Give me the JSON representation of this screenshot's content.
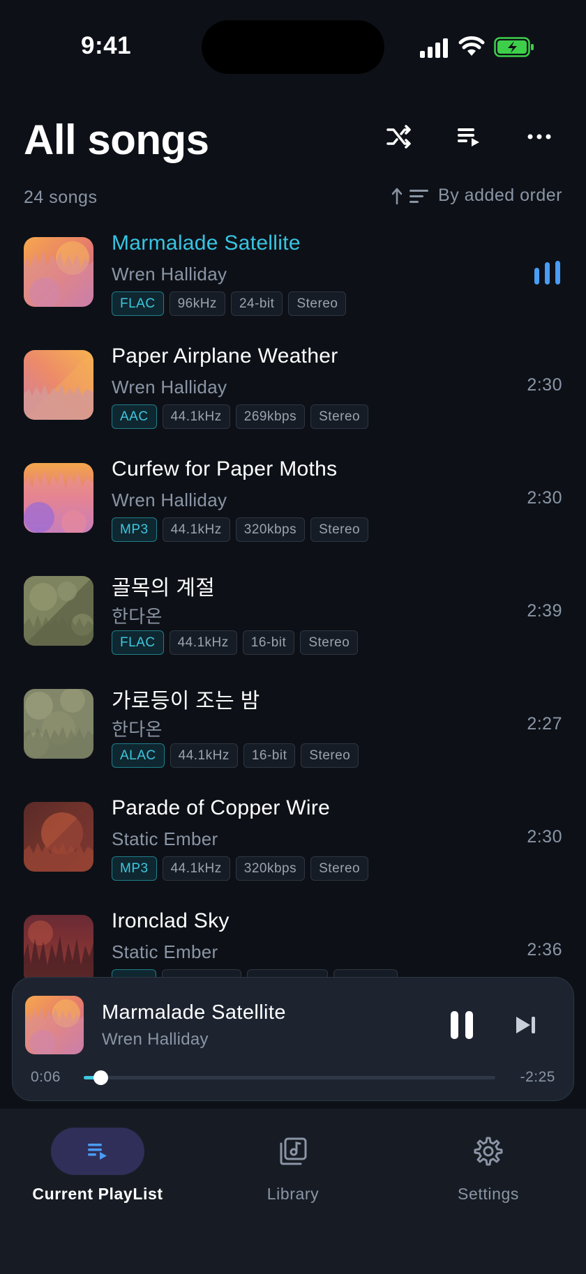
{
  "status_bar": {
    "time": "9:41"
  },
  "header": {
    "title": "All songs",
    "song_count": "24 songs",
    "sort_label": "By added order"
  },
  "songs": [
    {
      "title": "Marmalade Satellite",
      "artist": "Wren Halliday",
      "codec": "FLAC",
      "rate": "96kHz",
      "depth": "24-bit",
      "channels": "Stereo",
      "duration": "",
      "playing": true,
      "cover": "warm"
    },
    {
      "title": "Paper Airplane Weather",
      "artist": "Wren Halliday",
      "codec": "AAC",
      "rate": "44.1kHz",
      "depth": "269kbps",
      "channels": "Stereo",
      "duration": "2:30",
      "playing": false,
      "cover": "warm"
    },
    {
      "title": "Curfew for Paper Moths",
      "artist": "Wren Halliday",
      "codec": "MP3",
      "rate": "44.1kHz",
      "depth": "320kbps",
      "channels": "Stereo",
      "duration": "2:30",
      "playing": false,
      "cover": "warm"
    },
    {
      "title": "골목의 계절",
      "artist": "한다온",
      "codec": "FLAC",
      "rate": "44.1kHz",
      "depth": "16-bit",
      "channels": "Stereo",
      "duration": "2:39",
      "playing": false,
      "cover": "olive"
    },
    {
      "title": "가로등이 조는 밤",
      "artist": "한다온",
      "codec": "ALAC",
      "rate": "44.1kHz",
      "depth": "16-bit",
      "channels": "Stereo",
      "duration": "2:27",
      "playing": false,
      "cover": "olive"
    },
    {
      "title": "Parade of Copper Wire",
      "artist": "Static Ember",
      "codec": "MP3",
      "rate": "44.1kHz",
      "depth": "320kbps",
      "channels": "Stereo",
      "duration": "2:30",
      "playing": false,
      "cover": "ember"
    },
    {
      "title": "Ironclad Sky",
      "artist": "Static Ember",
      "codec": "",
      "rate": "",
      "depth": "",
      "channels": "",
      "duration": "2:36",
      "playing": false,
      "cover": "ember"
    }
  ],
  "now_playing": {
    "title": "Marmalade Satellite",
    "artist": "Wren Halliday",
    "elapsed": "0:06",
    "remaining": "-2:25",
    "progress": 0.04
  },
  "tabs": [
    {
      "label": "Current PlayList",
      "icon": "playlist-icon",
      "active": true
    },
    {
      "label": "Library",
      "icon": "library-icon",
      "active": false
    },
    {
      "label": "Settings",
      "icon": "settings-icon",
      "active": false
    }
  ],
  "colors": {
    "accent": "#38c4e3",
    "background": "#0d1117",
    "active_tab": "#302f59"
  }
}
